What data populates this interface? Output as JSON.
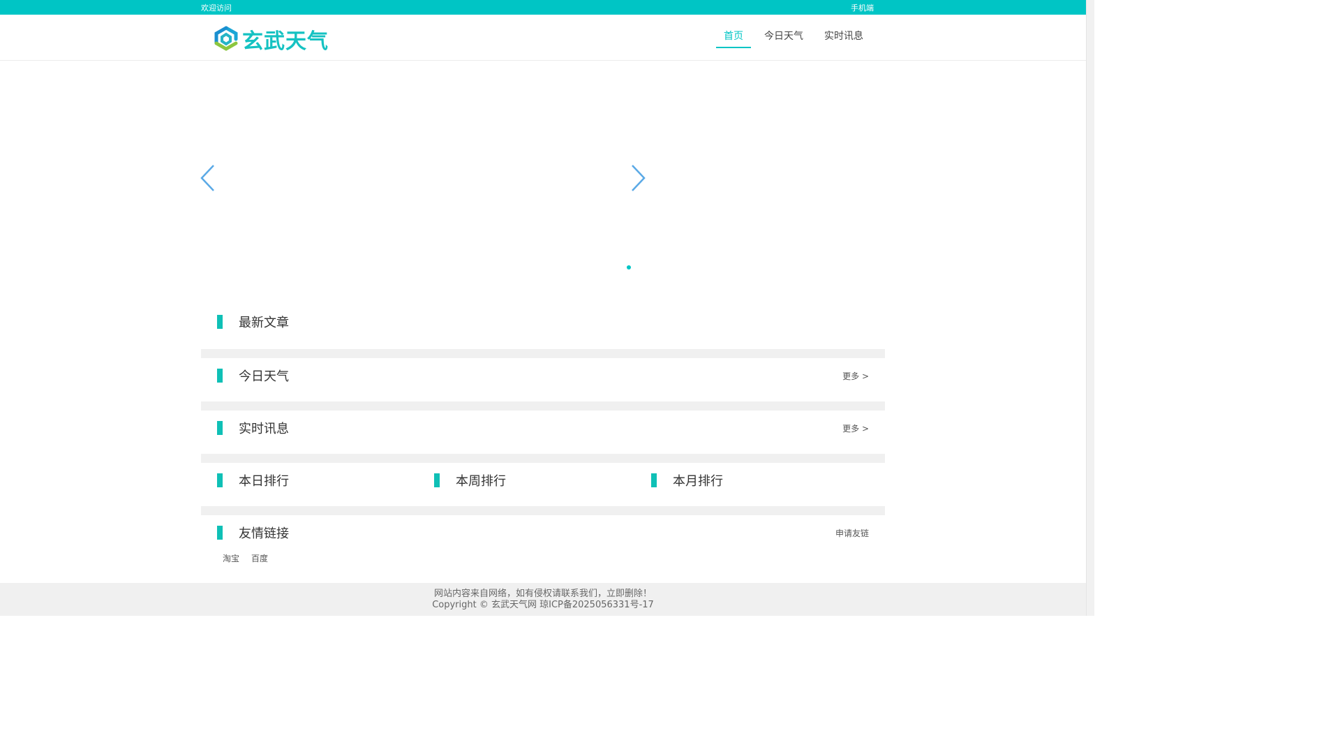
{
  "topbar": {
    "welcome": "欢迎访问",
    "mobile": "手机端"
  },
  "header": {
    "logo_text": "玄武天气",
    "nav": [
      {
        "label": "首页",
        "active": true
      },
      {
        "label": "今日天气",
        "active": false
      },
      {
        "label": "实时讯息",
        "active": false
      }
    ]
  },
  "carousel": {
    "dots": 1,
    "active_dot": 1
  },
  "sections": {
    "latest": {
      "title": "最新文章"
    },
    "today": {
      "title": "今日天气",
      "more": "更多 >"
    },
    "realtime": {
      "title": "实时讯息",
      "more": "更多 >"
    },
    "ranks": [
      {
        "title": "本日排行"
      },
      {
        "title": "本周排行"
      },
      {
        "title": "本月排行"
      }
    ],
    "friends": {
      "title": "友情链接",
      "apply": "申请友链",
      "links": [
        "淘宝",
        "百度"
      ]
    }
  },
  "footer": {
    "line1": "网站内容来自网络，如有侵权请联系我们，立即删除！",
    "line2": "Copyright © 玄武天气网 琼ICP备2025056331号-17"
  },
  "colors": {
    "accent": "#00c5c5",
    "bar": "#0fc0b6",
    "separator": "#f0f0f0"
  }
}
